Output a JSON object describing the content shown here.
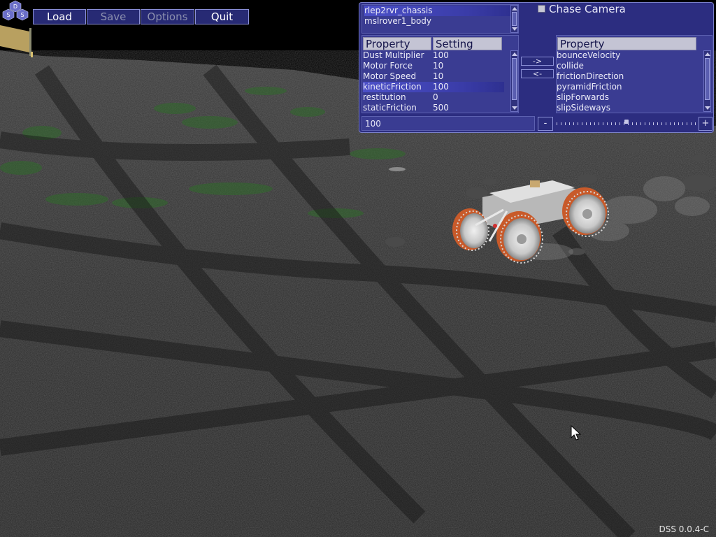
{
  "menu": {
    "load_label": "Load",
    "save_label": "Save",
    "options_label": "Options",
    "quit_label": "Quit"
  },
  "logo": {
    "letters": [
      "D",
      "S",
      "S"
    ]
  },
  "panel": {
    "objects": [
      "rlep2rvr_chassis",
      "mslrover1_body"
    ],
    "chase_camera_label": "Chase Camera",
    "chase_camera_checked": false,
    "left_table": {
      "headers": [
        "Property",
        "Setting"
      ],
      "rows": [
        {
          "property": "Dust Multiplier",
          "setting": "100"
        },
        {
          "property": "Motor Force",
          "setting": "10"
        },
        {
          "property": "Motor Speed",
          "setting": "10"
        },
        {
          "property": "kineticFriction",
          "setting": "100"
        },
        {
          "property": "restitution",
          "setting": "0"
        },
        {
          "property": "staticFriction",
          "setting": "500"
        }
      ],
      "selected_index": 3
    },
    "right_table": {
      "header": "Property",
      "rows": [
        "bounceVelocity",
        "collide",
        "frictionDirection",
        "pyramidFriction",
        "slipForwards",
        "slipSideways"
      ]
    },
    "move_right_label": "->",
    "move_left_label": "<-",
    "value_field": "100",
    "minus_label": "-",
    "plus_label": "+"
  },
  "version": "DSS 0.0.4-C",
  "colors": {
    "panel_bg": "#2c2d80",
    "button_bg": "#272a74",
    "selection": "#4c50c8",
    "wheel_orange": "#c85a2a"
  }
}
